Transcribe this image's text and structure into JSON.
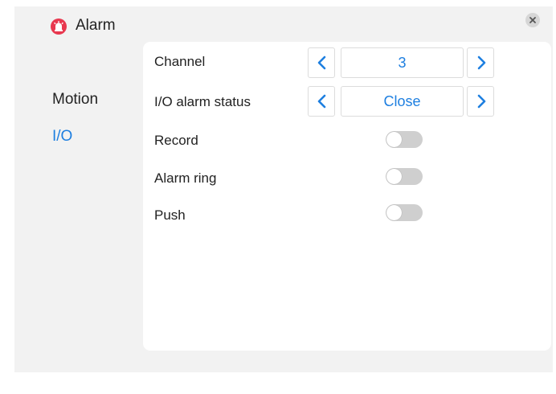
{
  "window": {
    "title": "Alarm",
    "title_icon": "alarm-siren-icon",
    "close_icon": "close-icon"
  },
  "sidebar": {
    "items": [
      {
        "label": "Motion",
        "active": false
      },
      {
        "label": "I/O",
        "active": true
      }
    ]
  },
  "settings": {
    "channel": {
      "label": "Channel",
      "value": "3"
    },
    "io_alarm_status": {
      "label": "I/O alarm status",
      "value": "Close"
    },
    "record": {
      "label": "Record",
      "enabled": false
    },
    "alarm_ring": {
      "label": "Alarm ring",
      "enabled": false
    },
    "push": {
      "label": "Push",
      "enabled": false
    }
  },
  "colors": {
    "accent": "#1e7fe0",
    "title_icon": "#e8384f",
    "toggle_off": "#cfcfcf",
    "window_bg": "#f2f2f2",
    "panel_bg": "#ffffff"
  }
}
